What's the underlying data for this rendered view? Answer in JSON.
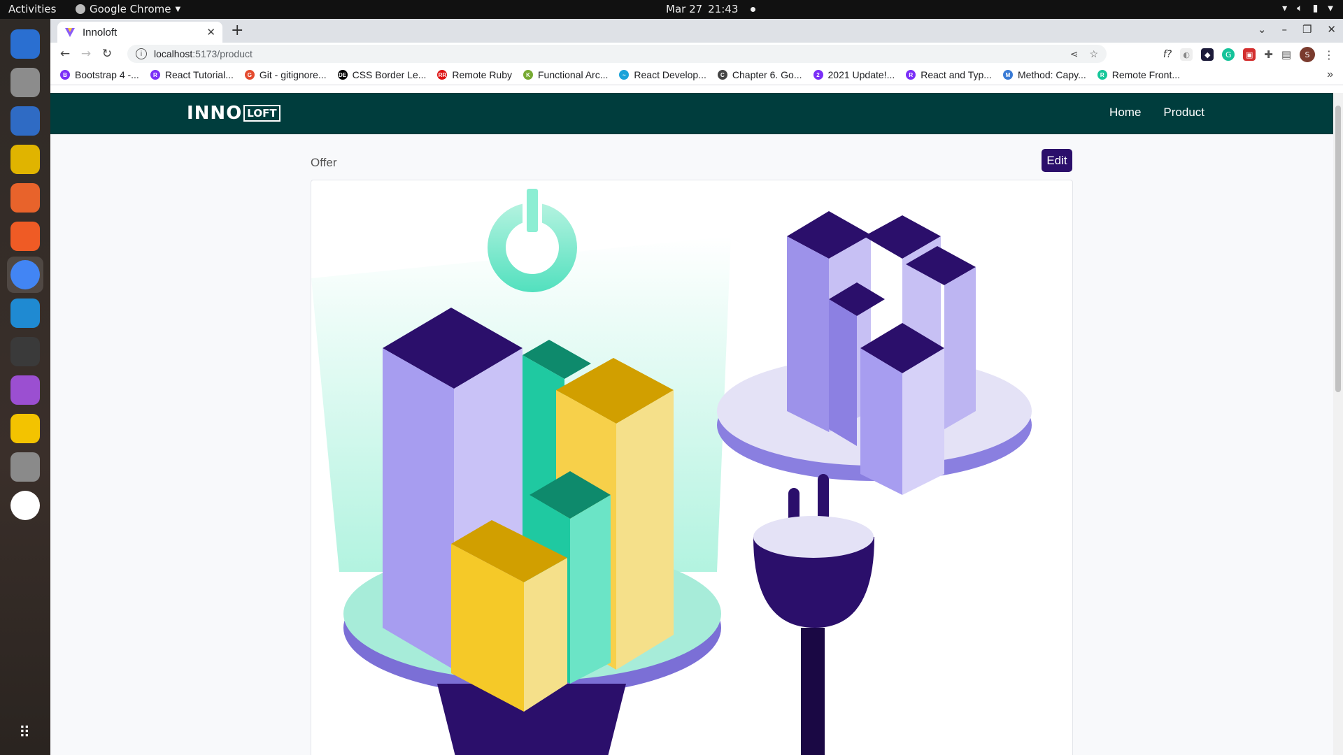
{
  "system_bar": {
    "activities": "Activities",
    "app_name": "Google Chrome",
    "date": "Mar 27",
    "time": "21:43"
  },
  "dock": {
    "items": [
      {
        "name": "thunderbird",
        "color": "#2a6fd1"
      },
      {
        "name": "files",
        "color": "#8c8c8c"
      },
      {
        "name": "writer",
        "color": "#2f6bc4"
      },
      {
        "name": "rhythmbox",
        "color": "#e0b400"
      },
      {
        "name": "firefox",
        "color": "#e8632b"
      },
      {
        "name": "postman",
        "color": "#ef5b25"
      },
      {
        "name": "chrome",
        "color": "#4285f4"
      },
      {
        "name": "vscode",
        "color": "#1f8ad2"
      },
      {
        "name": "terminal",
        "color": "#3a3a3a"
      },
      {
        "name": "media-player",
        "color": "#9b4fd1"
      },
      {
        "name": "beekeeper",
        "color": "#f3c300"
      },
      {
        "name": "settings",
        "color": "#8a8a8a"
      },
      {
        "name": "slack",
        "color": "#ffffff"
      }
    ]
  },
  "browser": {
    "tab_title": "Innoloft",
    "url_host": "localhost",
    "url_path": ":5173/product",
    "bookmarks": [
      {
        "label": "Bootstrap 4 -...",
        "color": "#7b2ff7",
        "glyph": "B"
      },
      {
        "label": "React Tutorial...",
        "color": "#7b2ff7",
        "glyph": "R"
      },
      {
        "label": "Git - gitignore...",
        "color": "#e44c30",
        "glyph": "G"
      },
      {
        "label": "CSS Border Le...",
        "color": "#000000",
        "glyph": "DEV"
      },
      {
        "label": "Remote Ruby",
        "color": "#d11",
        "glyph": "RR"
      },
      {
        "label": "Functional Arc...",
        "color": "#7a3",
        "glyph": "K"
      },
      {
        "label": "React Develop...",
        "color": "#1aa3d9",
        "glyph": "~"
      },
      {
        "label": "Chapter 6. Go...",
        "color": "#444",
        "glyph": "C"
      },
      {
        "label": "2021 Update!...",
        "color": "#7b2ff7",
        "glyph": "2"
      },
      {
        "label": "React and Typ...",
        "color": "#7b2ff7",
        "glyph": "R"
      },
      {
        "label": "Method: Capy...",
        "color": "#3a7bd5",
        "glyph": "M"
      },
      {
        "label": "Remote Front...",
        "color": "#16c79a",
        "glyph": "R"
      }
    ]
  },
  "page": {
    "logo_main": "INNO",
    "logo_box": "LOFT",
    "nav": {
      "home": "Home",
      "product": "Product"
    },
    "offer_label": "Offer",
    "edit_label": "Edit",
    "brand_color": "#003d3d",
    "accent_color": "#2b0f6b"
  }
}
